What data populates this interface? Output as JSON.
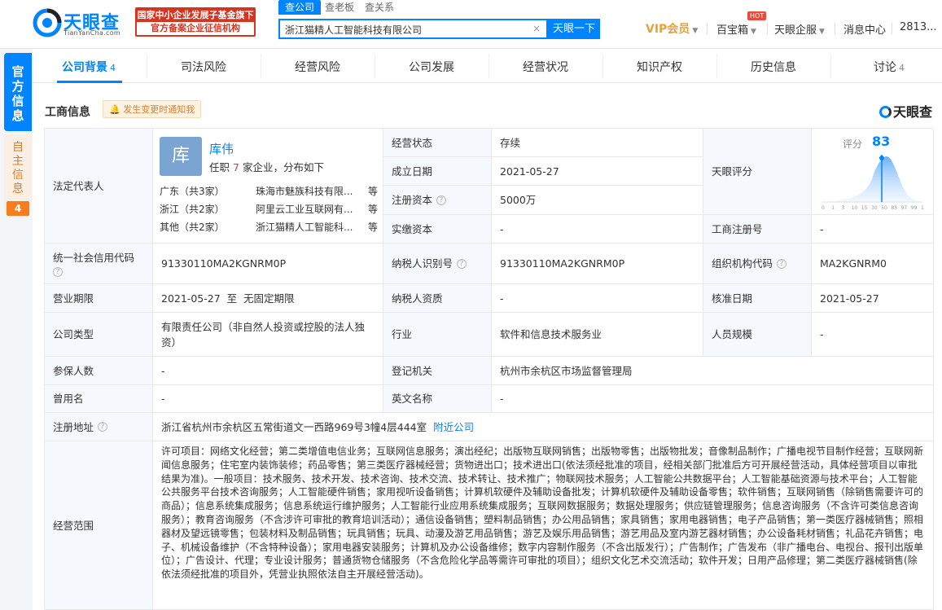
{
  "header": {
    "logo_text": "天眼查",
    "logo_sub": "TianYanCha.com",
    "promo_line1": "国家中小企业发展子基金旗下",
    "promo_line2": "官方备案企业征信机构",
    "search_tabs": [
      "查公司",
      "查老板",
      "查关系"
    ],
    "search_value": "浙江猫精人工智能科技有限公司",
    "search_clear": "×",
    "search_button": "天眼一下",
    "vip": "VIP会员",
    "baibao": "百宝箱",
    "hot": "HOT",
    "qiye": "天眼企服",
    "messages": "消息中心",
    "user": "2813..."
  },
  "side": {
    "official": [
      "官",
      "方",
      "信",
      "息"
    ],
    "self": [
      "自",
      "主",
      "信",
      "息"
    ],
    "self_count": "4"
  },
  "tabs": [
    {
      "label": "公司背景",
      "num": "4"
    },
    {
      "label": "司法风险",
      "num": ""
    },
    {
      "label": "经营风险",
      "num": ""
    },
    {
      "label": "公司发展",
      "num": ""
    },
    {
      "label": "经营状况",
      "num": ""
    },
    {
      "label": "知识产权",
      "num": ""
    },
    {
      "label": "历史信息",
      "num": ""
    },
    {
      "label": "讨论",
      "num": "4"
    }
  ],
  "section": {
    "title": "工商信息",
    "notify": "发生变更时通知我",
    "brand": "天眼查"
  },
  "legal": {
    "label": "法定代表人",
    "avatar": "库",
    "name": "库伟",
    "info_prefix": "任职",
    "info_num": "7",
    "info_suffix": "家企业，分布如下",
    "regions": [
      {
        "region": "广东（共3家）",
        "company": "珠海市魅族科技有限...",
        "etc": "等"
      },
      {
        "region": "浙江（共2家）",
        "company": "阿里云工业互联网有...",
        "etc": "等"
      },
      {
        "region": "其他（共2家）",
        "company": "浙江猫精人工智能科...",
        "etc": "等"
      }
    ]
  },
  "rows": {
    "status_label": "经营状态",
    "status": "存续",
    "founded_label": "成立日期",
    "founded": "2021-05-27",
    "reg_capital_label": "注册资本",
    "reg_capital": "5000万",
    "paid_capital_label": "实缴资本",
    "paid_capital": "-",
    "score_label": "天眼评分",
    "score_title": "评分",
    "score": "83",
    "score_ticks": [
      "0",
      "1",
      "3",
      "10",
      "15",
      "30",
      "50",
      "85",
      "97",
      "99",
      "100"
    ],
    "reg_no_label": "工商注册号",
    "reg_no": "-",
    "credit_code_label": "统一社会信用代码",
    "credit_code": "91330110MA2KGNRM0P",
    "taxpayer_id_label": "纳税人识别号",
    "taxpayer_id": "91330110MA2KGNRM0P",
    "org_code_label": "组织机构代码",
    "org_code": "MA2KGNRM0",
    "term_label": "营业期限",
    "term": "2021-05-27  至  无固定期限",
    "taxpayer_quality_label": "纳税人资质",
    "taxpayer_quality": "-",
    "approve_label": "核准日期",
    "approve": "2021-05-27",
    "type_label": "公司类型",
    "type": "有限责任公司（非自然人投资或控股的法人独资）",
    "industry_label": "行业",
    "industry": "软件和信息技术服务业",
    "staff_label": "人员规模",
    "staff": "-",
    "insured_label": "参保人数",
    "insured": "-",
    "authority_label": "登记机关",
    "authority": "杭州市余杭区市场监督管理局",
    "former_label": "曾用名",
    "former": "-",
    "english_label": "英文名称",
    "english": "-",
    "address_label": "注册地址",
    "address": "浙江省杭州市余杭区五常街道文一西路969号3幢4层444室",
    "address_link": "附近公司",
    "scope_label": "经营范围",
    "scope": "许可项目：网络文化经营；第二类增值电信业务；互联网信息服务；演出经纪；出版物互联网销售；出版物零售；出版物批发；音像制品制作；广播电视节目制作经营；互联网新闻信息服务；住宅室内装饰装修；药品零售；第三类医疗器械经营；货物进出口；技术进出口(依法须经批准的项目，经相关部门批准后方可开展经营活动，具体经营项目以审批结果为准)。一般项目：技术服务、技术开发、技术咨询、技术交流、技术转让、技术推广；物联网技术服务；人工智能公共数据平台；人工智能基础资源与技术平台；人工智能公共服务平台技术咨询服务；人工智能硬件销售；家用视听设备销售；计算机软硬件及辅助设备批发；计算机软硬件及辅助设备零售；软件销售；互联网销售（除销售需要许可的商品）；信息系统集成服务；信息系统运行维护服务；人工智能行业应用系统集成服务；互联网数据服务；数据处理服务；供应链管理服务；信息咨询服务（不含许可类信息咨询服务）；教育咨询服务（不含涉许可审批的教育培训活动）；通信设备销售；塑料制品销售；办公用品销售；家具销售；家用电器销售；电子产品销售；第一类医疗器械销售；照相器材及望远镜零售；包装材料及制品销售；玩具销售；玩具、动漫及游艺用品销售；游艺及娱乐用品销售；游艺用品及室内游艺器材销售；办公设备耗材销售；礼品花卉销售；电子、机械设备维护（不含特种设备）；家用电器安装服务；计算机及办公设备维修；数字内容制作服务（不含出版发行）；广告制作；广告发布（非广播电台、电视台、报刊出版单位）；广告设计、代理；专业设计服务；普通货物仓储服务（不含危险化学品等需许可审批的项目）；组织文化艺术交流活动；软件开发；日用产品修理；第二类医疗器械销售(除依法须经批准的项目外，凭营业执照依法自主开展经营活动)。"
  },
  "help_icon": "?"
}
